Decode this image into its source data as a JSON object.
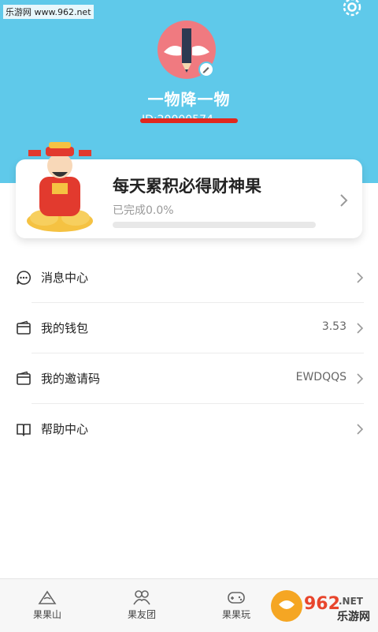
{
  "watermark_top": "乐游网 www.962.net",
  "profile": {
    "username": "一物降一物",
    "user_id": "ID:20000574"
  },
  "task_card": {
    "title": "每天累积必得财神果",
    "progress_text": "已完成0.0%",
    "progress": 0.0
  },
  "menu": [
    {
      "label": "消息中心",
      "value": "",
      "icon": "message-icon"
    },
    {
      "label": "我的钱包",
      "value": "3.53",
      "icon": "wallet-icon"
    },
    {
      "label": "我的邀请码",
      "value": "EWDQQS",
      "icon": "invite-code-icon"
    },
    {
      "label": "帮助中心",
      "value": "",
      "icon": "book-icon"
    }
  ],
  "tabs": [
    {
      "label": "果果山",
      "icon": "mountain-icon"
    },
    {
      "label": "果友团",
      "icon": "group-icon"
    },
    {
      "label": "果果玩",
      "icon": "gamepad-icon"
    }
  ],
  "watermark_bottom": {
    "number": "962",
    "suffix": ".NET",
    "text": "乐游网"
  },
  "colors": {
    "accent": "#5fc9ea",
    "avatar_bg": "#f07a80",
    "strike": "#e0281e"
  }
}
